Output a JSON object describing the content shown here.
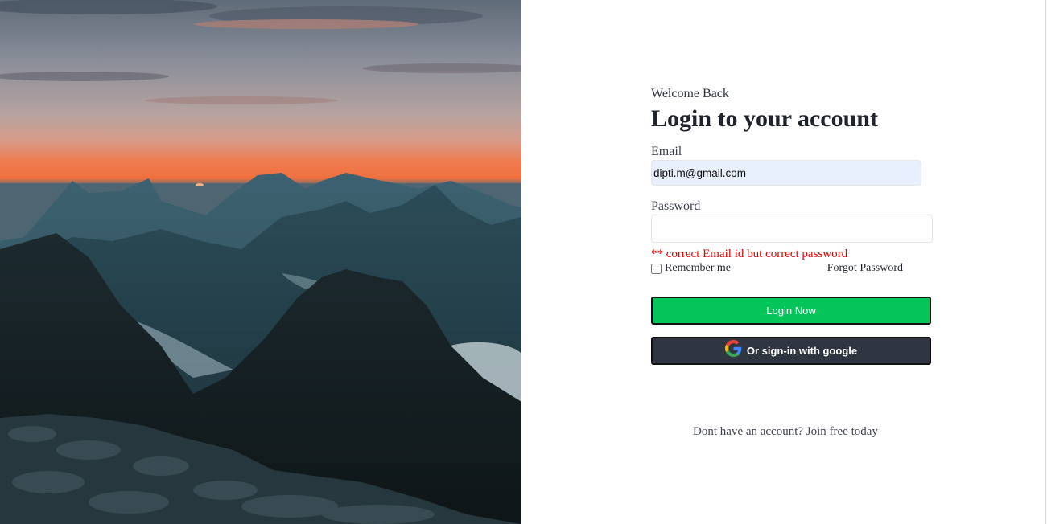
{
  "login": {
    "welcome": "Welcome Back",
    "heading": "Login to your account",
    "email_label": "Email",
    "email_value": "dipti.m@gmail.com",
    "password_label": "Password",
    "password_value": "",
    "error_text": "** correct Email id but correct password",
    "remember_label": "Remember me",
    "forgot_label": "Forgot Password",
    "login_button": "Login Now",
    "google_button": "Or sign-in with google",
    "signup_text": "Dont have an account? Join free today"
  },
  "colors": {
    "login_button": "#04c55a",
    "google_button": "#2f3541",
    "error": "#e00000",
    "email_autofill": "#e8f0fe"
  },
  "icons": {
    "google": "google-g-icon"
  }
}
